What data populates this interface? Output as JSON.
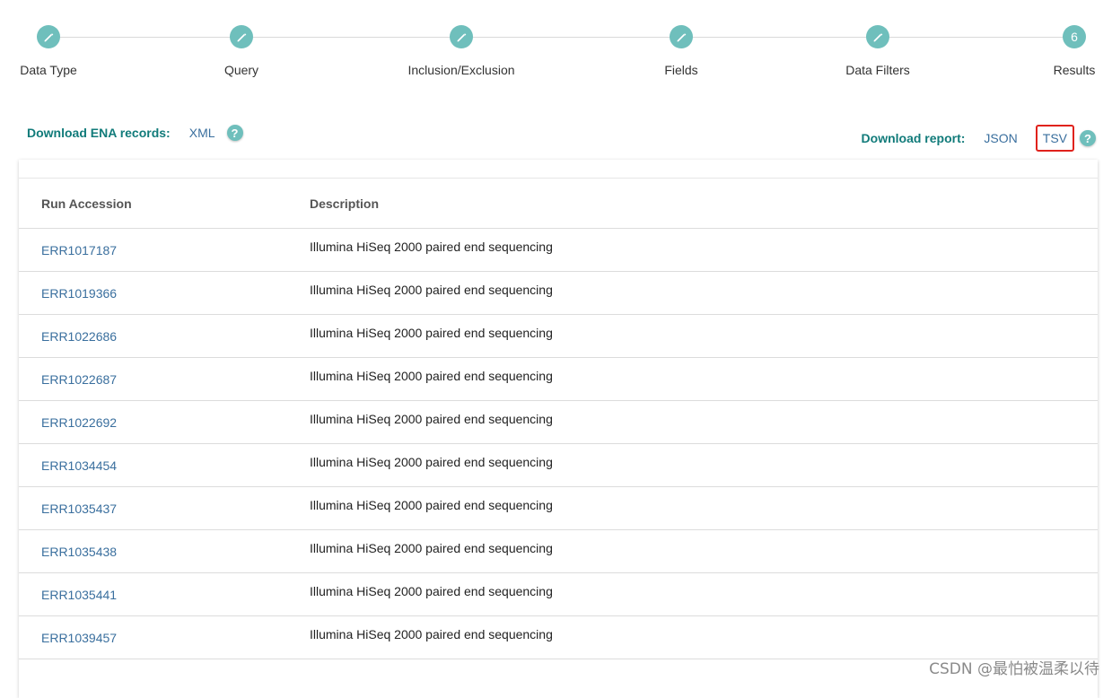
{
  "stepper": {
    "steps": [
      {
        "label": "Data Type",
        "marker": "pencil-icon"
      },
      {
        "label": "Query",
        "marker": "pencil-icon"
      },
      {
        "label": "Inclusion/Exclusion",
        "marker": "pencil-icon"
      },
      {
        "label": "Fields",
        "marker": "pencil-icon"
      },
      {
        "label": "Data Filters",
        "marker": "pencil-icon"
      },
      {
        "label": "Results",
        "number": "6"
      }
    ],
    "accent_color": "#6fbfbc"
  },
  "download": {
    "records_title": "Download ENA records:",
    "records_xml": "XML",
    "report_title": "Download report:",
    "report_json": "JSON",
    "report_tsv": "TSV",
    "help_glyph": "?",
    "highlight_color": "#e0221c"
  },
  "table": {
    "headers": [
      "Run Accession",
      "Description"
    ],
    "rows": [
      {
        "accession": "ERR1017187",
        "description": "Illumina HiSeq 2000 paired end sequencing"
      },
      {
        "accession": "ERR1019366",
        "description": "Illumina HiSeq 2000 paired end sequencing"
      },
      {
        "accession": "ERR1022686",
        "description": "Illumina HiSeq 2000 paired end sequencing"
      },
      {
        "accession": "ERR1022687",
        "description": "Illumina HiSeq 2000 paired end sequencing"
      },
      {
        "accession": "ERR1022692",
        "description": "Illumina HiSeq 2000 paired end sequencing"
      },
      {
        "accession": "ERR1034454",
        "description": "Illumina HiSeq 2000 paired end sequencing"
      },
      {
        "accession": "ERR1035437",
        "description": "Illumina HiSeq 2000 paired end sequencing"
      },
      {
        "accession": "ERR1035438",
        "description": "Illumina HiSeq 2000 paired end sequencing"
      },
      {
        "accession": "ERR1035441",
        "description": "Illumina HiSeq 2000 paired end sequencing"
      },
      {
        "accession": "ERR1039457",
        "description": "Illumina HiSeq 2000 paired end sequencing"
      }
    ]
  },
  "watermark": "CSDN @最怕被温柔以待"
}
